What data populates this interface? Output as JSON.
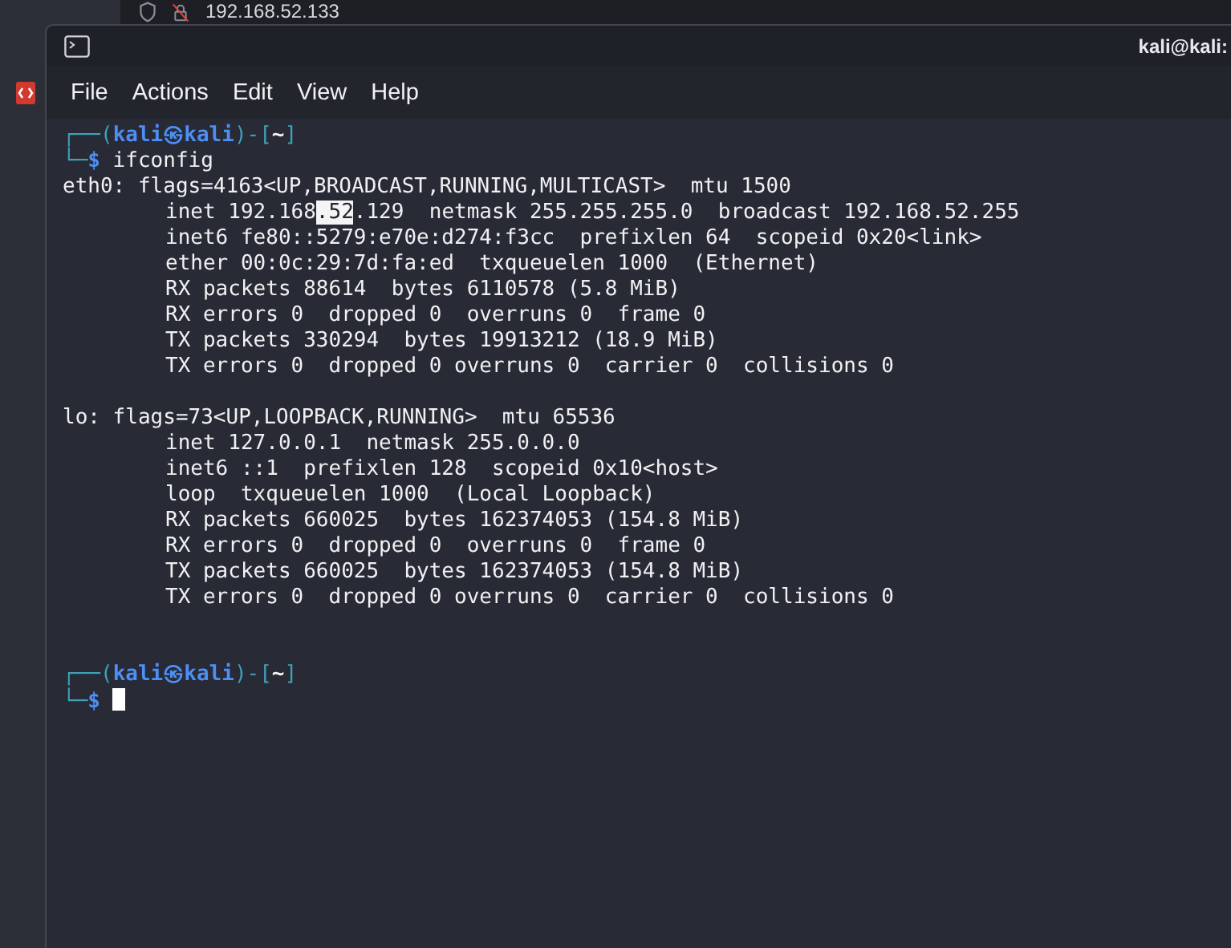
{
  "browser": {
    "url": "192.168.52.133"
  },
  "terminal": {
    "title": "kali@kali:",
    "menu": [
      "File",
      "Actions",
      "Edit",
      "View",
      "Help"
    ],
    "lines": [
      {
        "kind": "prompt",
        "open": "┌──(",
        "user": "kali",
        "at": "㉿",
        "host": "kali",
        "mid": ")-[",
        "dir": "~",
        "close": "]",
        "lead": "└─",
        "symbol": "$",
        "command": "ifconfig",
        "cursor": false
      },
      {
        "kind": "header",
        "parts": [
          {
            "text": "eth0: flags=4163<UP,BROADCAST,RUNNING,MULTICAST>  mtu 1500",
            "selected": false
          }
        ]
      },
      {
        "kind": "detail",
        "parts": [
          {
            "text": "inet 192.168",
            "selected": false
          },
          {
            "text": ".52",
            "selected": true
          },
          {
            "text": ".129  netmask 255.255.255.0  broadcast 192.168.52.255",
            "selected": false
          }
        ]
      },
      {
        "kind": "detail",
        "parts": [
          {
            "text": "inet6 fe80::5279:e70e:d274:f3cc  prefixlen 64  scopeid 0x20<link>",
            "selected": false
          }
        ]
      },
      {
        "kind": "detail",
        "parts": [
          {
            "text": "ether 00:0c:29:7d:fa:ed  txqueuelen 1000  (Ethernet)",
            "selected": false
          }
        ]
      },
      {
        "kind": "detail",
        "parts": [
          {
            "text": "RX packets 88614  bytes 6110578 (5.8 MiB)",
            "selected": false
          }
        ]
      },
      {
        "kind": "detail",
        "parts": [
          {
            "text": "RX errors 0  dropped 0  overruns 0  frame 0",
            "selected": false
          }
        ]
      },
      {
        "kind": "detail",
        "parts": [
          {
            "text": "TX packets 330294  bytes 19913212 (18.9 MiB)",
            "selected": false
          }
        ]
      },
      {
        "kind": "detail",
        "parts": [
          {
            "text": "TX errors 0  dropped 0 overruns 0  carrier 0  collisions 0",
            "selected": false
          }
        ]
      },
      {
        "kind": "blank"
      },
      {
        "kind": "header",
        "parts": [
          {
            "text": "lo: flags=73<UP,LOOPBACK,RUNNING>  mtu 65536",
            "selected": false
          }
        ]
      },
      {
        "kind": "detail",
        "parts": [
          {
            "text": "inet 127.0.0.1  netmask 255.0.0.0",
            "selected": false
          }
        ]
      },
      {
        "kind": "detail",
        "parts": [
          {
            "text": "inet6 ::1  prefixlen 128  scopeid 0x10<host>",
            "selected": false
          }
        ]
      },
      {
        "kind": "detail",
        "parts": [
          {
            "text": "loop  txqueuelen 1000  (Local Loopback)",
            "selected": false
          }
        ]
      },
      {
        "kind": "detail",
        "parts": [
          {
            "text": "RX packets 660025  bytes 162374053 (154.8 MiB)",
            "selected": false
          }
        ]
      },
      {
        "kind": "detail",
        "parts": [
          {
            "text": "RX errors 0  dropped 0  overruns 0  frame 0",
            "selected": false
          }
        ]
      },
      {
        "kind": "detail",
        "parts": [
          {
            "text": "TX packets 660025  bytes 162374053 (154.8 MiB)",
            "selected": false
          }
        ]
      },
      {
        "kind": "detail",
        "parts": [
          {
            "text": "TX errors 0  dropped 0 overruns 0  carrier 0  collisions 0",
            "selected": false
          }
        ]
      },
      {
        "kind": "blank"
      },
      {
        "kind": "blank"
      },
      {
        "kind": "prompt",
        "open": "┌──(",
        "user": "kali",
        "at": "㉿",
        "host": "kali",
        "mid": ")-[",
        "dir": "~",
        "close": "]",
        "lead": "└─",
        "symbol": "$",
        "cursor": true
      }
    ]
  }
}
